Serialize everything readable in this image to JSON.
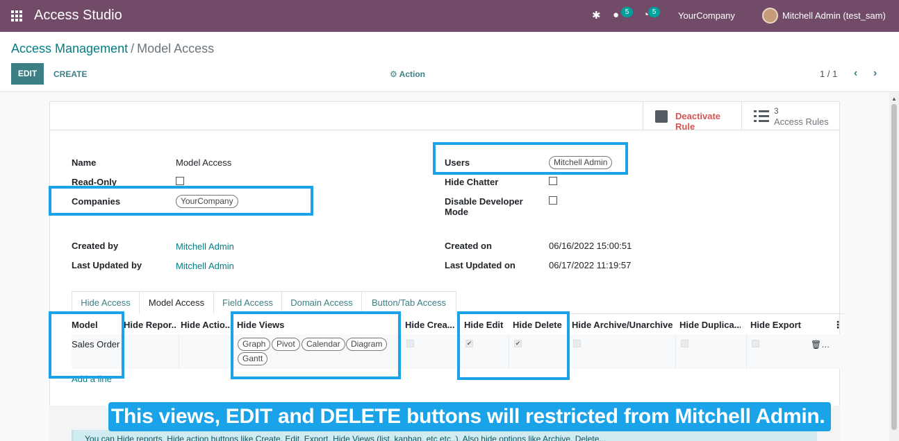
{
  "navbar": {
    "app_title": "Access Studio",
    "chat_badge": "5",
    "activity_badge": "5",
    "company": "YourCompany",
    "user": "Mitchell Admin (test_sam)"
  },
  "breadcrumb": {
    "parent": "Access Management",
    "separator": "/",
    "current": "Model Access"
  },
  "toolbar": {
    "edit_label": "EDIT",
    "create_label": "CREATE",
    "action_label": "Action",
    "pager": "1 / 1"
  },
  "smart_buttons": {
    "deactivate_label": "Deactivate Rule",
    "rules_count": "3",
    "rules_label": "Access Rules"
  },
  "form": {
    "name_label": "Name",
    "name_value": "Model Access",
    "readonly_label": "Read-Only",
    "companies_label": "Companies",
    "companies_tag": "YourCompany",
    "users_label": "Users",
    "users_tag": "Mitchell Admin",
    "hide_chatter_label": "Hide Chatter",
    "disable_dev_label_1": "Disable Developer",
    "disable_dev_label_2": "Mode",
    "created_by_label": "Created by",
    "created_by_value": "Mitchell Admin",
    "last_updated_by_label": "Last Updated by",
    "last_updated_by_value": "Mitchell Admin",
    "created_on_label": "Created on",
    "created_on_value": "06/16/2022 15:00:51",
    "last_updated_on_label": "Last Updated on",
    "last_updated_on_value": "06/17/2022 11:19:57"
  },
  "tabs": [
    "Hide Access",
    "Model Access",
    "Field Access",
    "Domain Access",
    "Button/Tab Access"
  ],
  "table": {
    "headers": [
      "Model",
      "Hide Repor...",
      "Hide Actio...",
      "Hide Views",
      "Hide Crea...",
      "Hide Edit",
      "Hide Delete",
      "Hide Archive/Unarchive",
      "Hide Duplica...",
      "Hide Export"
    ],
    "row": {
      "model": "Sales Order",
      "views": [
        "Graph",
        "Pivot",
        "Calendar",
        "Diagram",
        "Gantt"
      ],
      "hide_edit": "✔",
      "hide_delete": "✔"
    },
    "add_line": "Add a line"
  },
  "info_text": "You can Hide reports, Hide action buttons like Create, Edit, Export, Hide Views (list, kanban, etc etc..). Also hide options like Archive, Delete...",
  "overlay_text": "This views, EDIT and DELETE buttons will restricted from Mitchell Admin.",
  "colors": {
    "navbar": "#714b67",
    "primary": "#3b7f85",
    "highlight": "#1aa3e8",
    "danger": "#d9534f"
  }
}
